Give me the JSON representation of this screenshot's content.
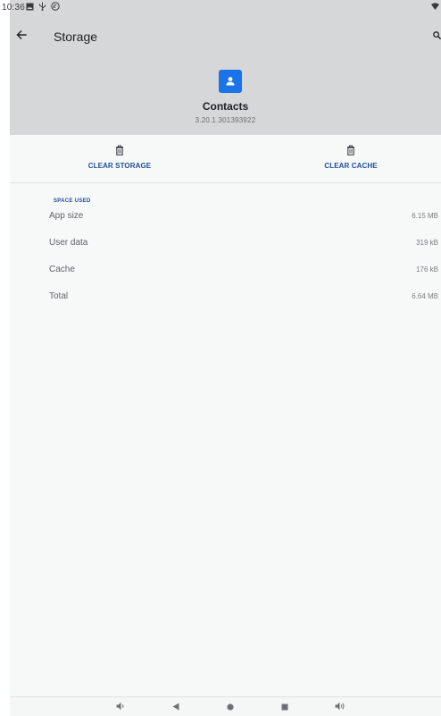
{
  "status_bar": {
    "time": "10:36",
    "icons": [
      "image-icon",
      "usb-icon",
      "cast-icon"
    ],
    "right_icon": "wifi-icon"
  },
  "header": {
    "title": "Storage",
    "back_icon": "arrow-back-icon",
    "search_icon": "search-icon"
  },
  "app": {
    "name": "Contacts",
    "version": "3.20.1.301393922",
    "icon": "contacts-icon",
    "icon_color": "#1a73e8"
  },
  "actions": {
    "clear_storage": "CLEAR STORAGE",
    "clear_cache": "CLEAR CACHE"
  },
  "space_used": {
    "title": "SPACE USED",
    "rows": [
      {
        "label": "App size",
        "value": "6.15 MB"
      },
      {
        "label": "User data",
        "value": "319 kB"
      },
      {
        "label": "Cache",
        "value": "176 kB"
      },
      {
        "label": "Total",
        "value": "6.64 MB"
      }
    ]
  },
  "nav_bar": {
    "items": [
      "volume-down-icon",
      "back-triangle-icon",
      "home-circle-icon",
      "recents-square-icon",
      "volume-up-icon"
    ]
  },
  "colors": {
    "accent": "#1d4e9a",
    "header_bg": "#d6d7d9",
    "background": "#f7f8f8"
  }
}
